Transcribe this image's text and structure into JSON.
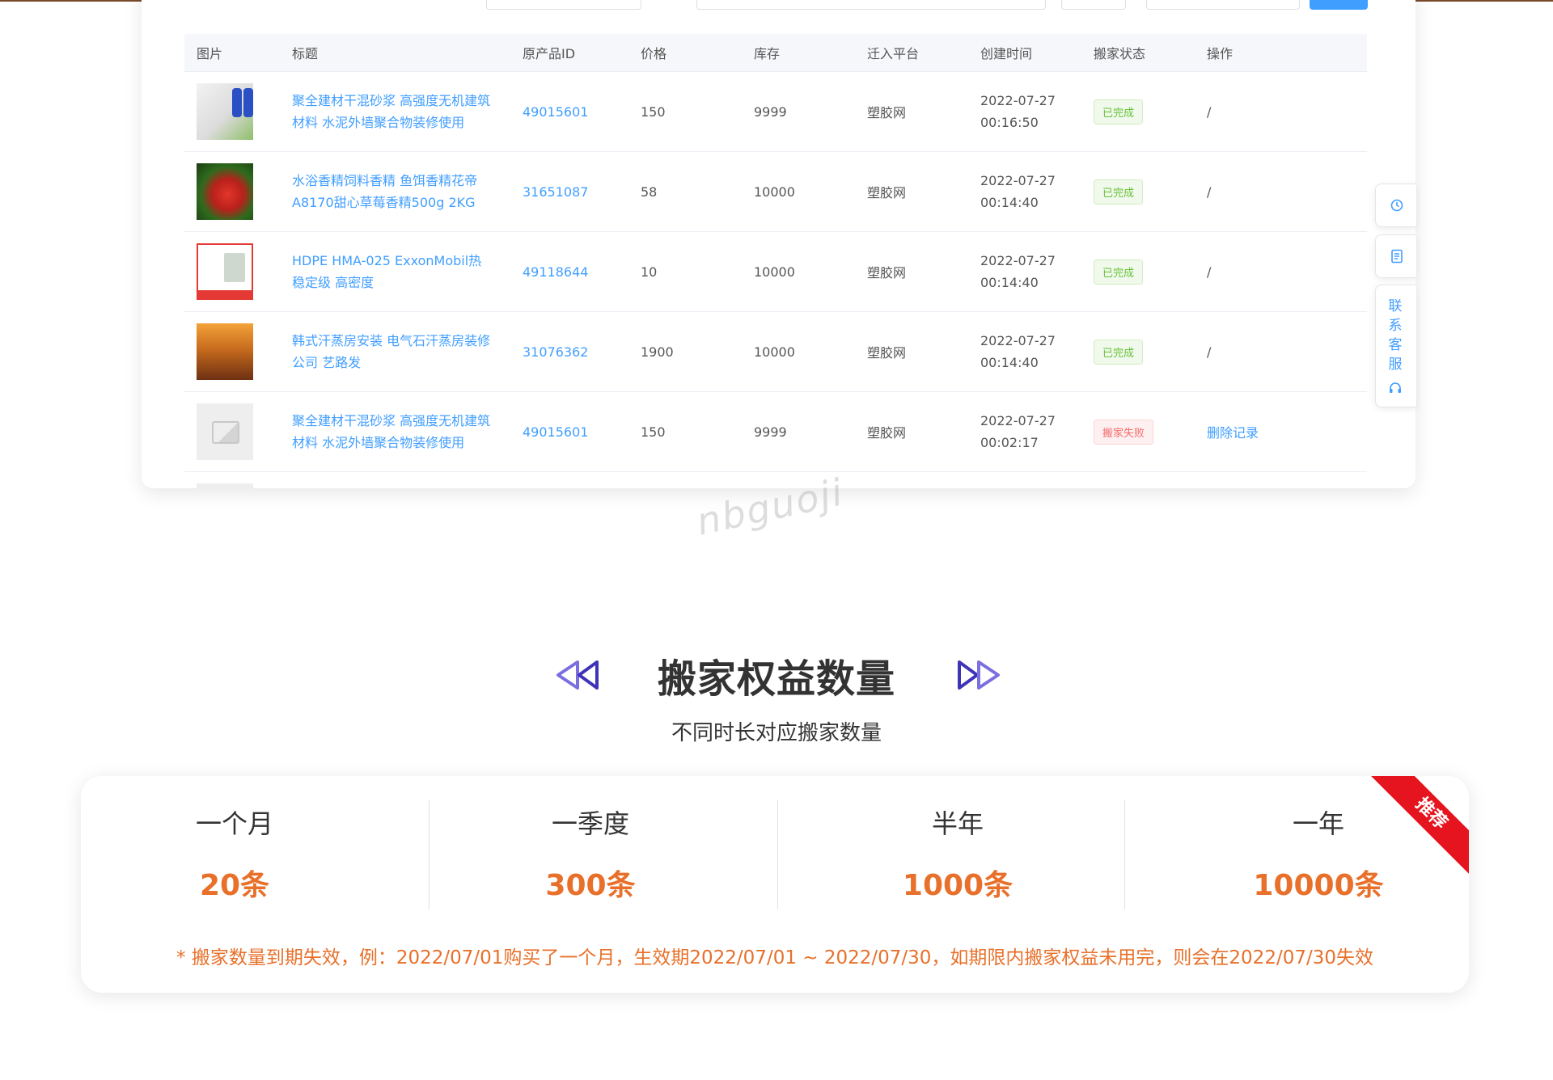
{
  "table": {
    "headers": {
      "image": "图片",
      "title": "标题",
      "source_id": "原产品ID",
      "price": "价格",
      "stock": "库存",
      "platform": "迁入平台",
      "created": "创建时间",
      "status": "搬家状态",
      "action": "操作"
    },
    "rows": [
      {
        "title": "聚全建材干混砂浆 高强度无机建筑材料 水泥外墙聚合物装修使用",
        "source_id": "49015601",
        "price": "150",
        "stock": "9999",
        "platform": "塑胶网",
        "created": "2022-07-27 00:16:50",
        "status": "已完成",
        "action": "/"
      },
      {
        "title": "水浴香精饲料香精 鱼饵香精花帝A8170甜心草莓香精500g 2KG",
        "source_id": "31651087",
        "price": "58",
        "stock": "10000",
        "platform": "塑胶网",
        "created": "2022-07-27 00:14:40",
        "status": "已完成",
        "action": "/"
      },
      {
        "title": "HDPE HMA-025 ExxonMobil热稳定级 高密度",
        "source_id": "49118644",
        "price": "10",
        "stock": "10000",
        "platform": "塑胶网",
        "created": "2022-07-27 00:14:40",
        "status": "已完成",
        "action": "/"
      },
      {
        "title": "韩式汗蒸房安装 电气石汗蒸房装修公司 艺路发",
        "source_id": "31076362",
        "price": "1900",
        "stock": "10000",
        "platform": "塑胶网",
        "created": "2022-07-27 00:14:40",
        "status": "已完成",
        "action": "/"
      },
      {
        "title": "聚全建材干混砂浆 高强度无机建筑材料 水泥外墙聚合物装修使用",
        "source_id": "49015601",
        "price": "150",
        "stock": "9999",
        "platform": "塑胶网",
        "created": "2022-07-27 00:02:17",
        "status": "搬家失败",
        "action": "删除记录"
      }
    ]
  },
  "sidebar": {
    "service_label": "联系客服",
    "service_chars": [
      "联",
      "系",
      "客",
      "服"
    ]
  },
  "watermark": "nbguoji",
  "section": {
    "title": "搬家权益数量",
    "subtitle": "不同时长对应搬家数量"
  },
  "plans": [
    {
      "name": "一个月",
      "count": "20条"
    },
    {
      "name": "一季度",
      "count": "300条"
    },
    {
      "name": "半年",
      "count": "1000条"
    },
    {
      "name": "一年",
      "count": "10000条"
    }
  ],
  "ribbon": "推荐",
  "note": "* 搬家数量到期失效，例：2022/07/01购买了一个月，生效期2022/07/01 ~ 2022/07/30，如期限内搬家权益未用完，则会在2022/07/30失效",
  "colors": {
    "link": "#409eff",
    "accent_orange": "#e8702a",
    "ribbon_red": "#e5141e",
    "success_green": "#67c23a",
    "fail_red": "#f56c6c",
    "arrow_purple": "#5b4fd6"
  }
}
